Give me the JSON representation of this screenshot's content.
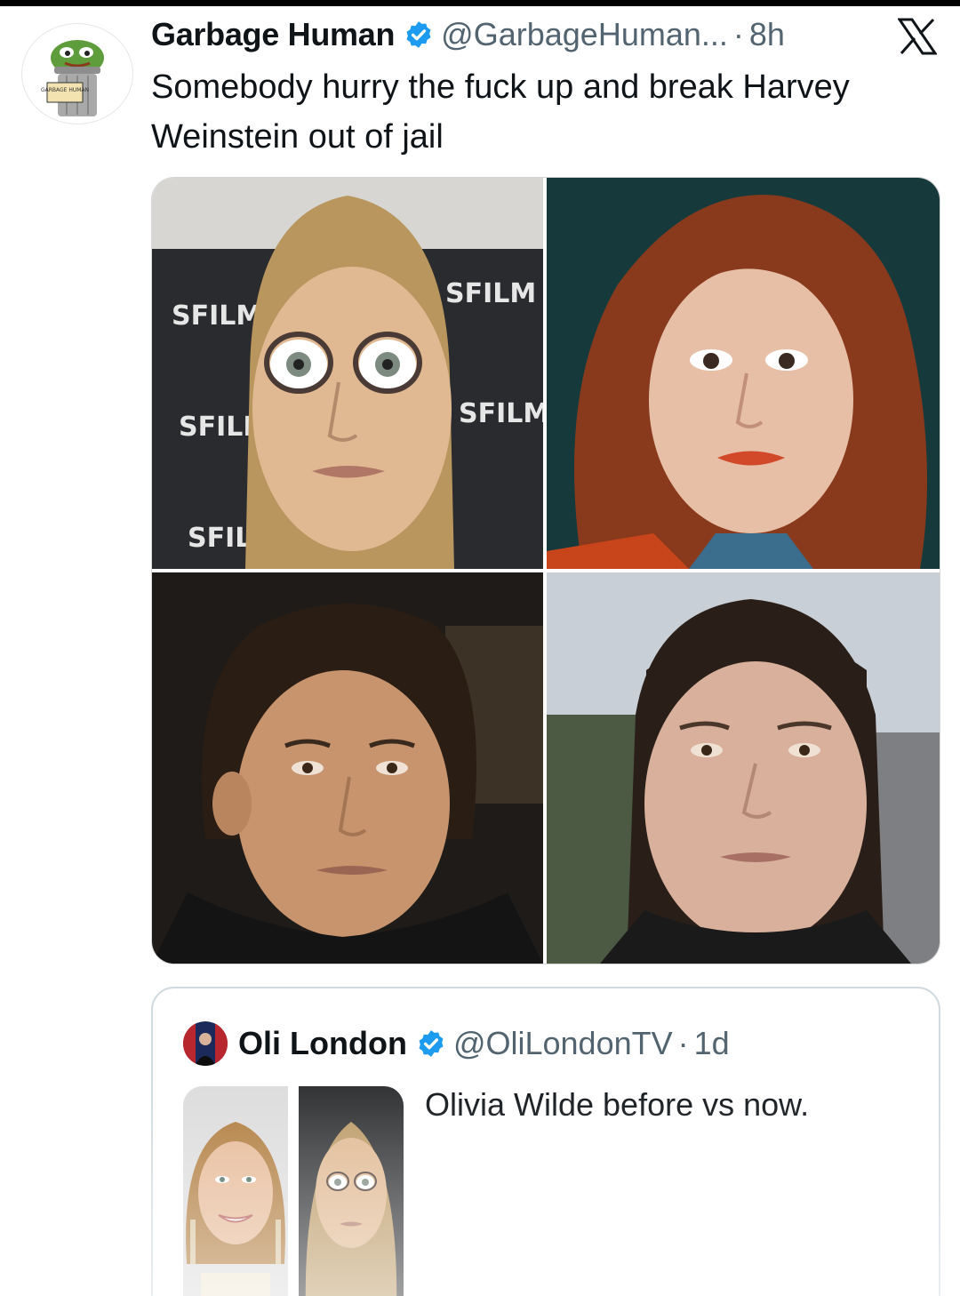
{
  "tweet": {
    "display_name": "Garbage Human",
    "handle": "@GarbageHuman...",
    "separator": "·",
    "time": "8h",
    "text": "Somebody hurry the fuck up and break Harvey Weinstein out of jail",
    "verified_icon": "verified-badge-icon",
    "platform_icon": "x-logo-icon",
    "avatar_sign_text": "GARBAGE HUMAN"
  },
  "media": {
    "photos": [
      {
        "name": "photo-top-left",
        "backdrop_text": "SFILM"
      },
      {
        "name": "photo-top-right"
      },
      {
        "name": "photo-bottom-left"
      },
      {
        "name": "photo-bottom-right"
      }
    ]
  },
  "quote": {
    "display_name": "Oli London",
    "handle": "@OliLondonTV",
    "separator": "·",
    "time": "1d",
    "text": "Olivia Wilde before vs now."
  },
  "colors": {
    "text_primary": "#0f1419",
    "text_secondary": "#536471",
    "verified_blue": "#1d9bf0",
    "border": "#cfd9de"
  }
}
